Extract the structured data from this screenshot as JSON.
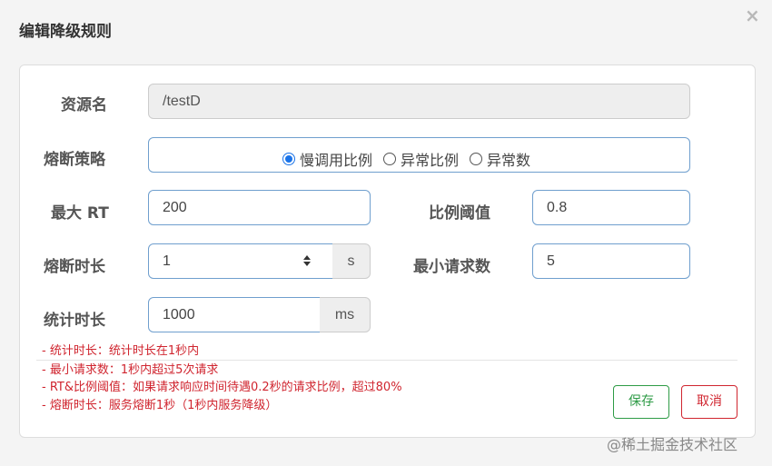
{
  "dialog": {
    "title": "编辑降级规则",
    "close_glyph": "×"
  },
  "form": {
    "resource": {
      "label": "资源名",
      "value": "/testD"
    },
    "strategy": {
      "label": "熔断策略",
      "options": [
        "慢调用比例",
        "异常比例",
        "异常数"
      ],
      "selected": "慢调用比例"
    },
    "max_rt": {
      "label": "最大 RT",
      "value": "200"
    },
    "ratio_threshold": {
      "label": "比例阈值",
      "value": "0.8"
    },
    "break_duration": {
      "label": "熔断时长",
      "value": "1",
      "unit": "s"
    },
    "min_requests": {
      "label": "最小请求数",
      "value": "5"
    },
    "stat_duration": {
      "label": "统计时长",
      "value": "1000",
      "unit": "ms"
    }
  },
  "hints": [
    "- 统计时长：统计时长在1秒内",
    "- 最小请求数：1秒内超过5次请求",
    "- RT&比例阈值：如果请求响应时间待遇0.2秒的请求比例，超过80%",
    "- 熔断时长：服务熔断1秒（1秒内服务降级）"
  ],
  "buttons": {
    "save": "保存",
    "cancel": "取消"
  },
  "colors": {
    "accent": "#1a73e8",
    "save": "#2e9b46",
    "cancel": "#d0252f",
    "hint": "#d0252f"
  },
  "watermark": "@稀土掘金技术社区"
}
